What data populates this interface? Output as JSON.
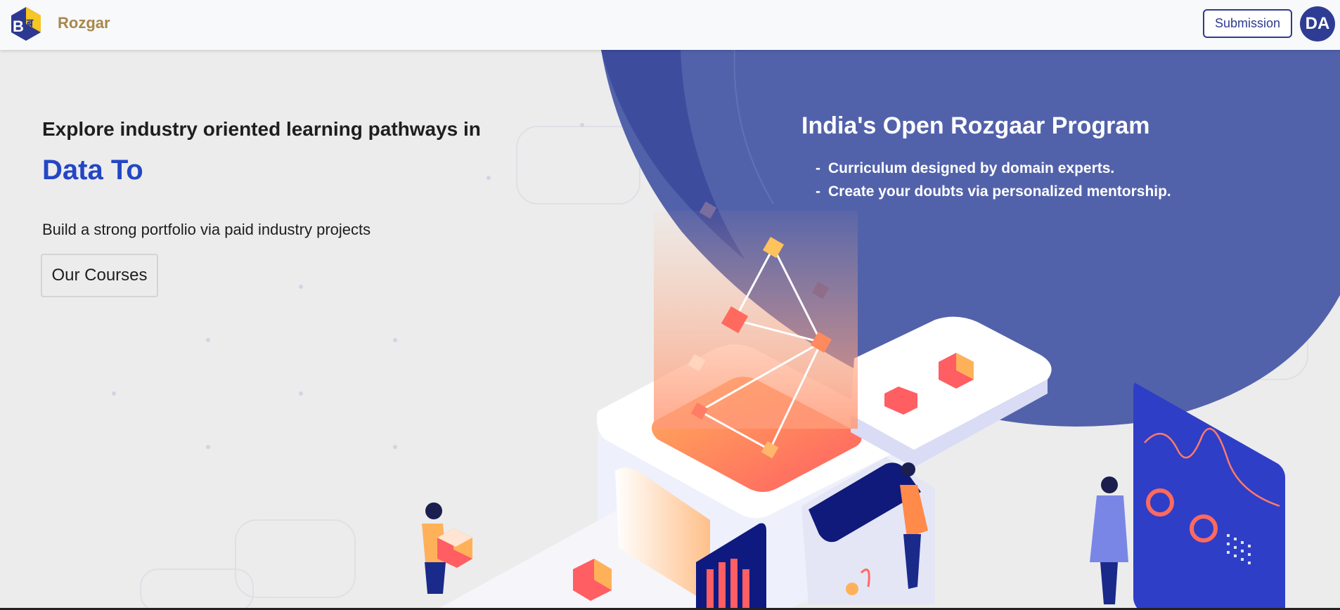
{
  "header": {
    "logo_text": "Bब",
    "brand": "Rozgar",
    "submission_label": "Submission",
    "avatar_initials": "DA"
  },
  "hero": {
    "eyebrow": "Explore industry oriented learning pathways in",
    "focus": "Data To",
    "subtitle": "Build a strong portfolio via paid industry projects",
    "courses_button": "Our Courses"
  },
  "program": {
    "title": "India's Open Rozgaar Program",
    "points": [
      "Curriculum designed by domain experts.",
      "Create your doubts via personalized mentorship."
    ]
  },
  "colors": {
    "accent": "#2346c5",
    "navy": "#2e3d93",
    "brand_gold": "#a8884a",
    "blob": "#5262aa"
  }
}
